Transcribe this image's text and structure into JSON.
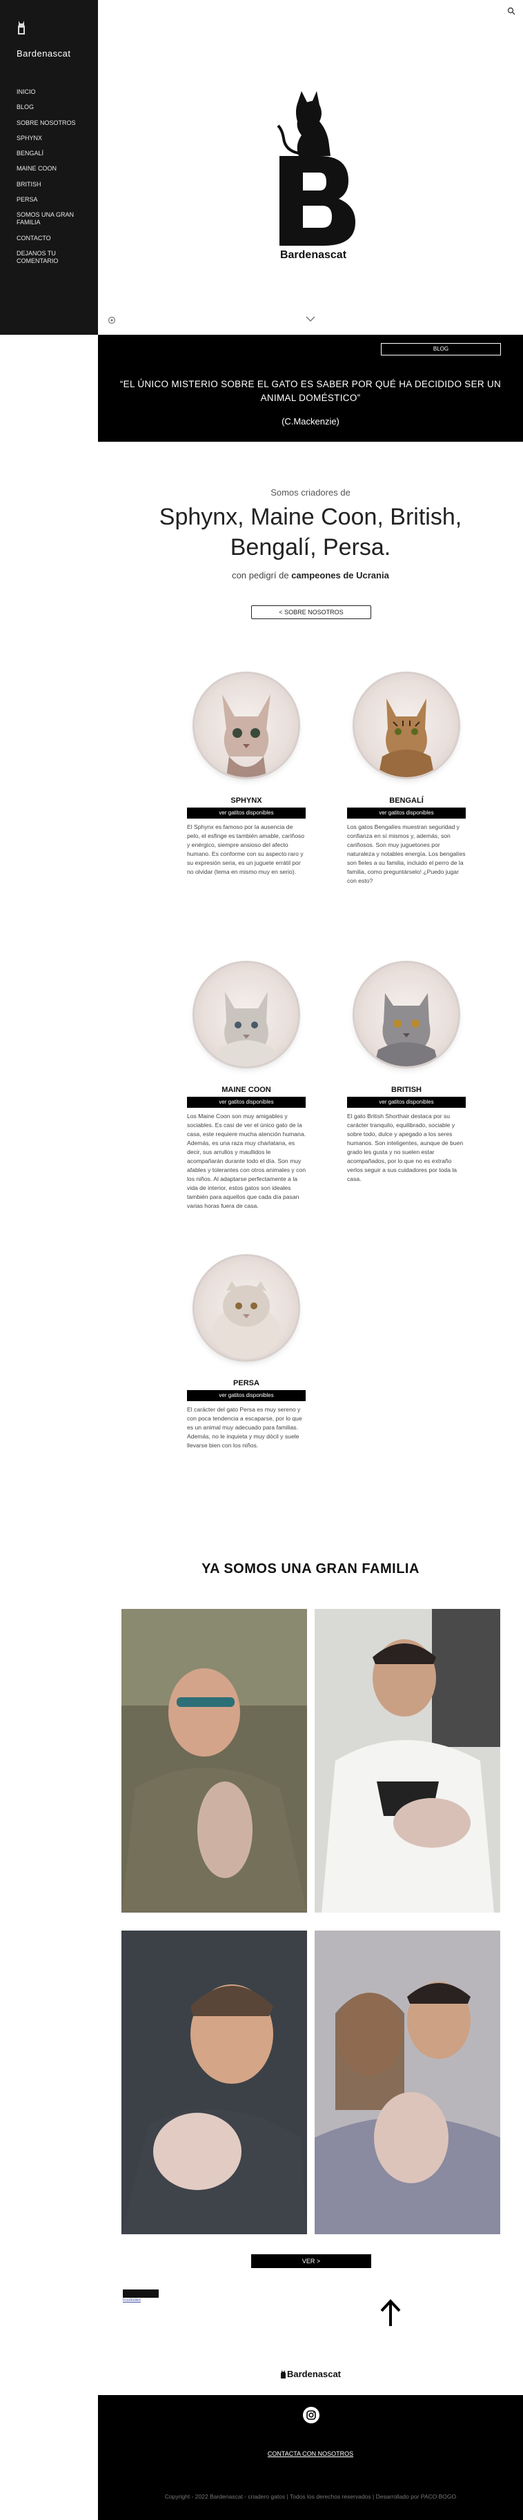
{
  "sidebar": {
    "brand": "Bardenascat",
    "nav": [
      "INICIO",
      "BLOG",
      "SOBRE NOSOTROS",
      "SPHYNX",
      "BENGALÍ",
      "MAINE COON",
      "BRITISH",
      "PERSA",
      "SOMOS UNA GRAN FAMILIA",
      "CONTACTO",
      "DEJANOS TU COMENTARIO"
    ]
  },
  "hero": {
    "name": "Bardenascat"
  },
  "quote": {
    "blog_button": "BLOG",
    "text": "“EL ÚNICO MISTERIO SOBRE EL GATO ES SABER POR QUÉ HA DECIDIDO SER UN ANIMAL DOMÉSTICO”",
    "author": "(C.Mackenzie)"
  },
  "intro": {
    "small": "Somos criadores de",
    "title": "Sphynx, Maine Coon, British, Bengalí, Persa.",
    "sub_prefix": "con pedigrí de ",
    "sub_bold": "campeones de Ucrania",
    "about_button": "< SOBRE NOSOTROS"
  },
  "breeds": [
    {
      "name": "SPHYNX",
      "available": "ver gatitos disponibles",
      "desc": "El Sphynx es famoso por la ausencia de pelo, el esfinge es también amable, cariñoso y enérgico, siempre ansioso del afecto humano. Es conforme con su aspecto raro y su expresión seria, es un juguete errátil por no olvidar (tema en mismo muy en serio)."
    },
    {
      "name": "BENGALÍ",
      "available": "ver gatitos disponibles",
      "desc": "Los gatos Bengalíes muestran seguridad y confianza en sí mismos y, además, son cariñosos. Son muy juguetones por naturaleza y notables energía. Los bengalíes son fieles a su familia, incluido el perro de la familia, como preguntárselo! ¿Puedo jugar con esto?"
    },
    {
      "name": "MAINE COON",
      "available": "ver gatitos disponibles",
      "desc": "Los Maine Coon son muy amigables y sociables. Es casi de ver el único gato de la casa, este requiere mucha atención humana. Además, es una raza muy charlatana, es decir, sus arrullos y maullidos le acompañarán durante todo el día. Son muy afables y tolerantes con otros animales y con los niños. Al adaptarse perfectamente a la vida de interior, estos gatos son ideales también para aquellos que cada día pasan varias horas fuera de casa."
    },
    {
      "name": "BRITISH",
      "available": "ver gatitos disponibles",
      "desc": "El gato British Shorthair destaca por su carácter tranquilo, equilibrado, sociable y sobre todo, dulce y apegado a los seres humanos. Son inteligentes, aunque de buen grado les gusta y no suelen estar acompañados, por lo que no es extraño verlos seguir a sus cuidadores por toda la casa."
    },
    {
      "name": "PERSA",
      "available": "ver gatitos disponibles",
      "desc": "El carácter del gato Persa es muy sereno y con poca tendencia a escaparse, por lo que es un animal muy adecuado para familias. Además, no le inquieta y muy dócil y suele llevarse bien con los niños."
    }
  ],
  "family": {
    "title": "YA SOMOS UNA GRAN FAMILIA",
    "see_more_button": "VER >"
  },
  "misc": {
    "mini_link": "trustindex"
  },
  "footer": {
    "logo_text": "Bardenascat",
    "contact": "CONTACTA CON NOSOTROS",
    "copyright": "Copyright - 2022 Bardenascat - criadero gatos | Todos los derechos reservados | Desarrollado por PACO BOGO"
  },
  "colors": {
    "black": "#000000",
    "sidebar": "#161616"
  }
}
